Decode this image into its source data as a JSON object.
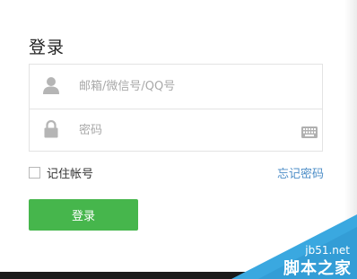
{
  "login": {
    "title": "登录",
    "account_placeholder": "邮箱/微信号/QQ号",
    "password_placeholder": "密码",
    "remember_label": "记住帐号",
    "forgot_label": "忘记密码",
    "submit_label": "登录"
  },
  "watermark": {
    "domain": "jb51.net",
    "name": "脚本之家"
  },
  "colors": {
    "accent_green": "#46b64c",
    "link_blue": "#4d8ec7",
    "watermark_blue": "#3aa8e0"
  }
}
